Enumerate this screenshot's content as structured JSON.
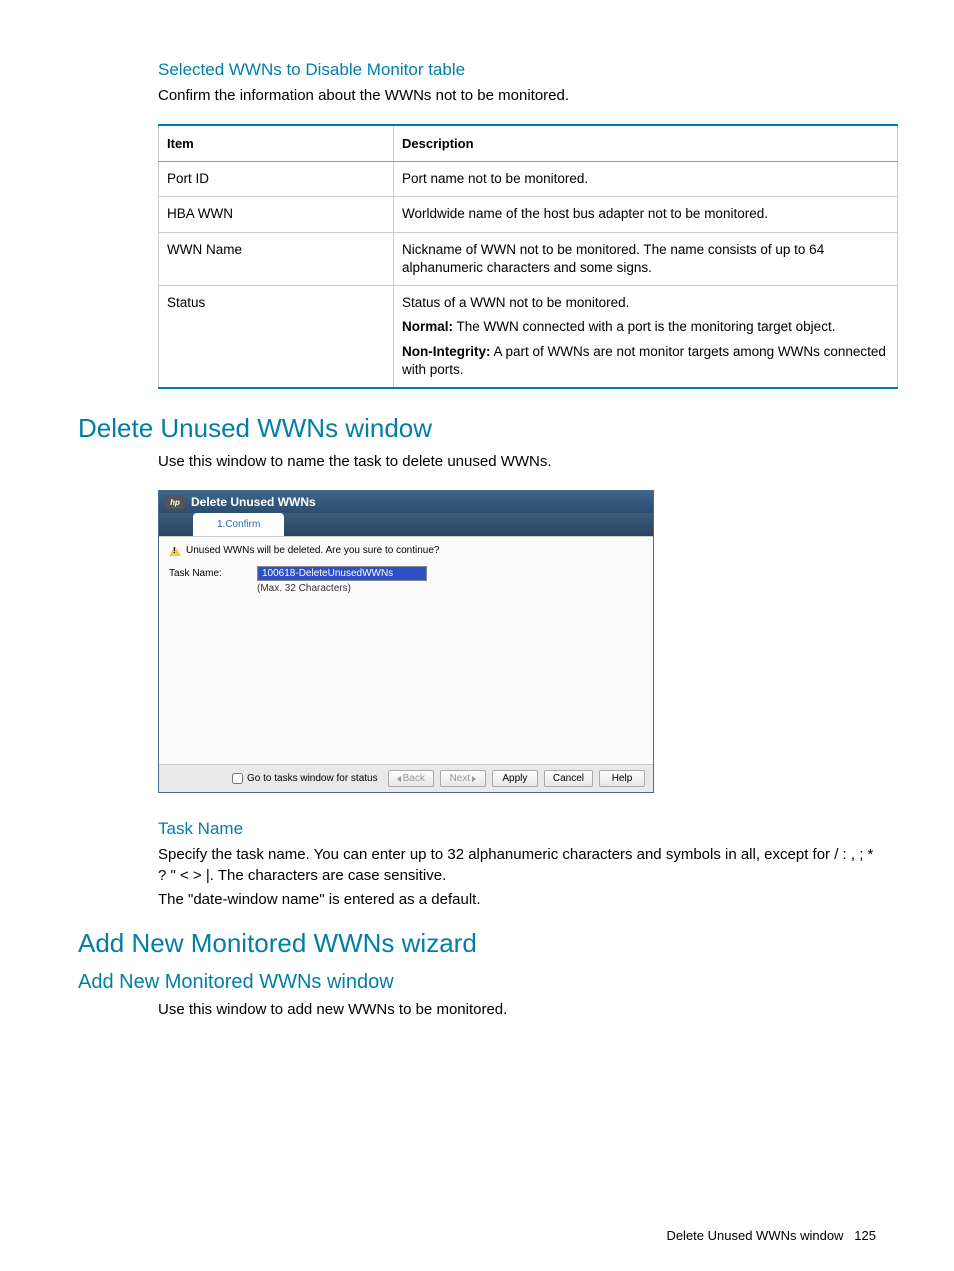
{
  "section1": {
    "title": "Selected WWNs to Disable Monitor table",
    "intro": "Confirm the information about the WWNs not to be monitored."
  },
  "table": {
    "headers": {
      "item": "Item",
      "desc": "Description"
    },
    "rows": [
      {
        "item": "Port ID",
        "desc": "Port name not to be monitored."
      },
      {
        "item": "HBA WWN",
        "desc": "Worldwide name of the host bus adapter not to be monitored."
      },
      {
        "item": "WWN Name",
        "desc": "Nickname of WWN not to be monitored. The name consists of up to 64 alphanumeric characters and some signs."
      },
      {
        "item": "Status",
        "desc_line1": "Status of a WWN not to be monitored.",
        "normal_label": "Normal:",
        "normal_text": " The WWN connected with a port is the monitoring target object.",
        "nonint_label": "Non-Integrity:",
        "nonint_text": " A part of WWNs are not monitor targets among WWNs connected with ports."
      }
    ]
  },
  "section2": {
    "title": "Delete Unused WWNs window",
    "intro": "Use this window to name the task to delete unused WWNs."
  },
  "dialog": {
    "title": "Delete Unused WWNs",
    "tab": "1.Confirm",
    "warning": "Unused WWNs will be deleted. Are you sure to continue?",
    "task_label": "Task Name:",
    "task_value": "100618-DeleteUnusedWWNs",
    "task_hint": "(Max. 32 Characters)",
    "footer_check": "Go to tasks window for status",
    "btn_back": "Back",
    "btn_next": "Next",
    "btn_apply": "Apply",
    "btn_cancel": "Cancel",
    "btn_help": "Help"
  },
  "section3": {
    "title": "Task Name",
    "p1": "Specify the task name. You can enter up to 32 alphanumeric characters and symbols in all, except for / : , ; * ? \" < > |. The characters are case sensitive.",
    "p2": "The \"date-window name\" is entered as a default."
  },
  "section4": {
    "title": "Add New Monitored WWNs wizard"
  },
  "section5": {
    "title": "Add New Monitored WWNs window",
    "intro": "Use this window to add new WWNs to be monitored."
  },
  "footer": {
    "text": "Delete Unused WWNs window",
    "page": "125"
  }
}
